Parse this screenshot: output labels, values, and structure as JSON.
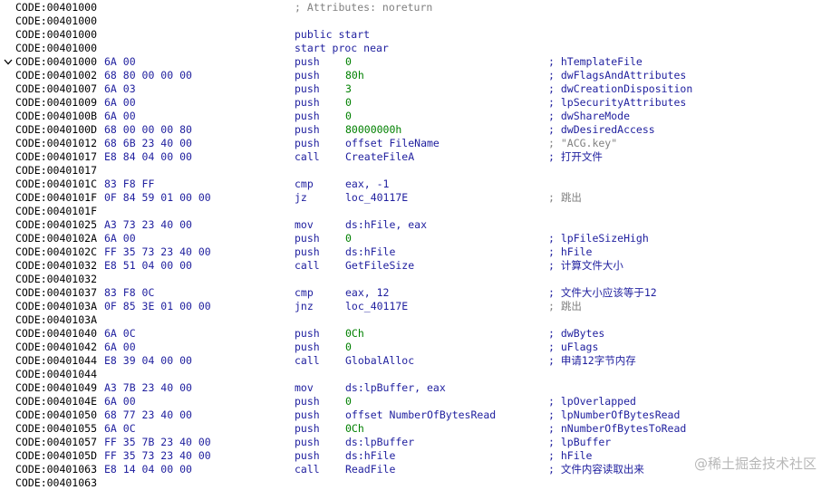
{
  "lines": [
    {
      "addr": "CODE:00401000",
      "bytes": "",
      "mnemonic": "",
      "operand": "",
      "comment": "",
      "text": "; Attributes: noreturn",
      "kind": "attr"
    },
    {
      "addr": "CODE:00401000",
      "bytes": "",
      "mnemonic": "",
      "operand": "",
      "comment": "",
      "text": "",
      "kind": "blank"
    },
    {
      "addr": "CODE:00401000",
      "bytes": "",
      "mnemonic": "",
      "operand": "",
      "comment": "",
      "text": "public start",
      "kind": "decl"
    },
    {
      "addr": "CODE:00401000",
      "bytes": "",
      "mnemonic": "",
      "operand": "",
      "comment": "",
      "text": "start proc near",
      "kind": "decl"
    },
    {
      "addr": "CODE:00401000",
      "bytes": "6A 00",
      "mnemonic": "push",
      "operand": "0",
      "comment": "; hTemplateFile",
      "kind": "code",
      "num": true,
      "arrow": true
    },
    {
      "addr": "CODE:00401002",
      "bytes": "68 80 00 00 00",
      "mnemonic": "push",
      "operand": "80h",
      "comment": "; dwFlagsAndAttributes",
      "kind": "code",
      "num": true
    },
    {
      "addr": "CODE:00401007",
      "bytes": "6A 03",
      "mnemonic": "push",
      "operand": "3",
      "comment": "; dwCreationDisposition",
      "kind": "code",
      "num": true
    },
    {
      "addr": "CODE:00401009",
      "bytes": "6A 00",
      "mnemonic": "push",
      "operand": "0",
      "comment": "; lpSecurityAttributes",
      "kind": "code",
      "num": true
    },
    {
      "addr": "CODE:0040100B",
      "bytes": "6A 00",
      "mnemonic": "push",
      "operand": "0",
      "comment": "; dwShareMode",
      "kind": "code",
      "num": true
    },
    {
      "addr": "CODE:0040100D",
      "bytes": "68 00 00 00 80",
      "mnemonic": "push",
      "operand": "80000000h",
      "comment": "; dwDesiredAccess",
      "kind": "code",
      "num": true
    },
    {
      "addr": "CODE:00401012",
      "bytes": "68 6B 23 40 00",
      "mnemonic": "push",
      "operand": "offset FileName",
      "comment": "; \"ACG.key\"",
      "kind": "code",
      "gray": true
    },
    {
      "addr": "CODE:00401017",
      "bytes": "E8 84 04 00 00",
      "mnemonic": "call",
      "operand": "CreateFileA",
      "comment": "; 打开文件",
      "kind": "code"
    },
    {
      "addr": "CODE:00401017",
      "bytes": "",
      "mnemonic": "",
      "operand": "",
      "comment": "",
      "text": "",
      "kind": "blank"
    },
    {
      "addr": "CODE:0040101C",
      "bytes": "83 F8 FF",
      "mnemonic": "cmp",
      "operand": "eax, -1",
      "comment": "",
      "kind": "code"
    },
    {
      "addr": "CODE:0040101F",
      "bytes": "0F 84 59 01 00 00",
      "mnemonic": "jz",
      "operand": "loc_40117E",
      "comment": "; 跳出",
      "kind": "code",
      "gray": true
    },
    {
      "addr": "CODE:0040101F",
      "bytes": "",
      "mnemonic": "",
      "operand": "",
      "comment": "",
      "text": "",
      "kind": "blank"
    },
    {
      "addr": "CODE:00401025",
      "bytes": "A3 73 23 40 00",
      "mnemonic": "mov",
      "operand": "ds:hFile, eax",
      "comment": "",
      "kind": "code"
    },
    {
      "addr": "CODE:0040102A",
      "bytes": "6A 00",
      "mnemonic": "push",
      "operand": "0",
      "comment": "; lpFileSizeHigh",
      "kind": "code",
      "num": true
    },
    {
      "addr": "CODE:0040102C",
      "bytes": "FF 35 73 23 40 00",
      "mnemonic": "push",
      "operand": "ds:hFile",
      "comment": "; hFile",
      "kind": "code"
    },
    {
      "addr": "CODE:00401032",
      "bytes": "E8 51 04 00 00",
      "mnemonic": "call",
      "operand": "GetFileSize",
      "comment": "; 计算文件大小",
      "kind": "code"
    },
    {
      "addr": "CODE:00401032",
      "bytes": "",
      "mnemonic": "",
      "operand": "",
      "comment": "",
      "text": "",
      "kind": "blank"
    },
    {
      "addr": "CODE:00401037",
      "bytes": "83 F8 0C",
      "mnemonic": "cmp",
      "operand": "eax, 12",
      "comment": "; 文件大小应该等于12",
      "kind": "code"
    },
    {
      "addr": "CODE:0040103A",
      "bytes": "0F 85 3E 01 00 00",
      "mnemonic": "jnz",
      "operand": "loc_40117E",
      "comment": "; 跳出",
      "kind": "code",
      "gray": true
    },
    {
      "addr": "CODE:0040103A",
      "bytes": "",
      "mnemonic": "",
      "operand": "",
      "comment": "",
      "text": "",
      "kind": "blank"
    },
    {
      "addr": "CODE:00401040",
      "bytes": "6A 0C",
      "mnemonic": "push",
      "operand": "0Ch",
      "comment": "; dwBytes",
      "kind": "code",
      "num": true
    },
    {
      "addr": "CODE:00401042",
      "bytes": "6A 00",
      "mnemonic": "push",
      "operand": "0",
      "comment": "; uFlags",
      "kind": "code",
      "num": true
    },
    {
      "addr": "CODE:00401044",
      "bytes": "E8 39 04 00 00",
      "mnemonic": "call",
      "operand": "GlobalAlloc",
      "comment": "; 申请12字节内存",
      "kind": "code"
    },
    {
      "addr": "CODE:00401044",
      "bytes": "",
      "mnemonic": "",
      "operand": "",
      "comment": "",
      "text": "",
      "kind": "blank"
    },
    {
      "addr": "CODE:00401049",
      "bytes": "A3 7B 23 40 00",
      "mnemonic": "mov",
      "operand": "ds:lpBuffer, eax",
      "comment": "",
      "kind": "code"
    },
    {
      "addr": "CODE:0040104E",
      "bytes": "6A 00",
      "mnemonic": "push",
      "operand": "0",
      "comment": "; lpOverlapped",
      "kind": "code",
      "num": true
    },
    {
      "addr": "CODE:00401050",
      "bytes": "68 77 23 40 00",
      "mnemonic": "push",
      "operand": "offset NumberOfBytesRead",
      "comment": "; lpNumberOfBytesRead",
      "kind": "code"
    },
    {
      "addr": "CODE:00401055",
      "bytes": "6A 0C",
      "mnemonic": "push",
      "operand": "0Ch",
      "comment": "; nNumberOfBytesToRead",
      "kind": "code",
      "num": true
    },
    {
      "addr": "CODE:00401057",
      "bytes": "FF 35 7B 23 40 00",
      "mnemonic": "push",
      "operand": "ds:lpBuffer",
      "comment": "; lpBuffer",
      "kind": "code"
    },
    {
      "addr": "CODE:0040105D",
      "bytes": "FF 35 73 23 40 00",
      "mnemonic": "push",
      "operand": "ds:hFile",
      "comment": "; hFile",
      "kind": "code"
    },
    {
      "addr": "CODE:00401063",
      "bytes": "E8 14 04 00 00",
      "mnemonic": "call",
      "operand": "ReadFile",
      "comment": "; 文件内容读取出来",
      "kind": "code"
    },
    {
      "addr": "CODE:00401063",
      "bytes": "",
      "mnemonic": "",
      "operand": "",
      "comment": "",
      "text": "",
      "kind": "blank"
    }
  ],
  "watermark": "@稀土掘金技术社区",
  "icons": {
    "collapse": "chevron-down-icon"
  },
  "colors": {
    "address": "#000000",
    "code": "#1e1e9e",
    "number": "#008000",
    "gray": "#808080"
  }
}
